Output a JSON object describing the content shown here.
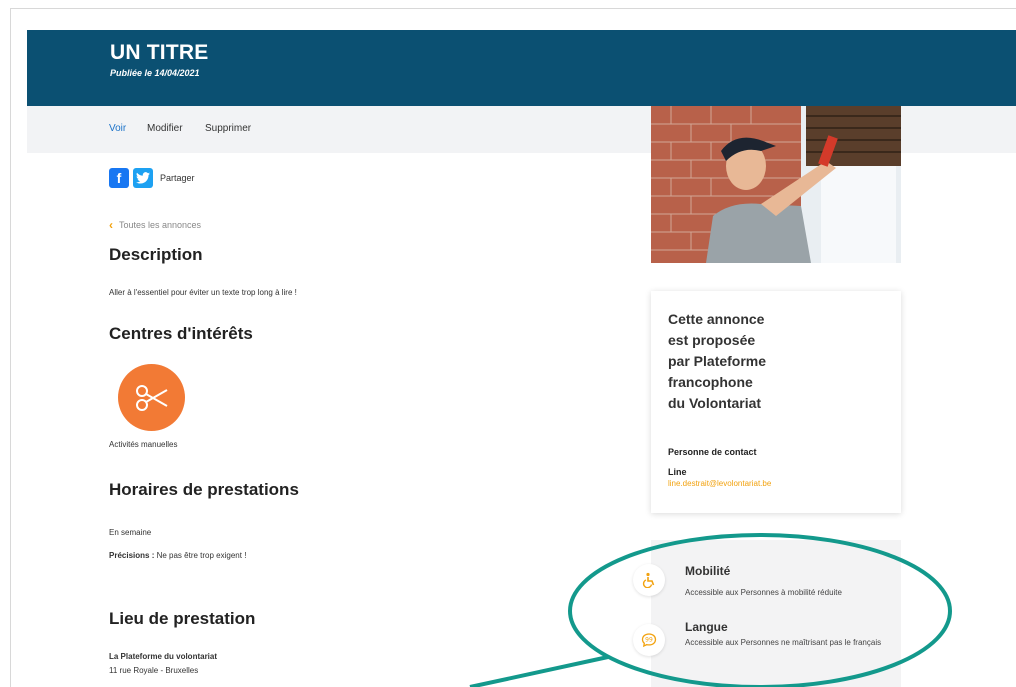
{
  "header": {
    "title": "UN TITRE",
    "date": "Publiée le 14/04/2021",
    "background": "#0b5072"
  },
  "tabs": [
    {
      "label": "Voir",
      "active": true
    },
    {
      "label": "Modifier",
      "active": false
    },
    {
      "label": "Supprimer",
      "active": false
    }
  ],
  "share": {
    "label": "Partager",
    "fb_letter": "f"
  },
  "back_link": "Toutes les annonces",
  "description": {
    "heading": "Description",
    "text": "Aller à l'essentiel pour éviter un texte trop long à lire !"
  },
  "interests": {
    "heading": "Centres d'intérêts",
    "items": [
      {
        "label": "Activités manuelles",
        "icon": "scissors-icon",
        "color": "#f27a35"
      }
    ]
  },
  "schedule": {
    "heading": "Horaires de prestations",
    "text": "En semaine",
    "precisions_label": "Précisions :",
    "precisions_text": " Ne pas être trop exigent !"
  },
  "location": {
    "heading": "Lieu de prestation",
    "name": "La Plateforme du volontariat",
    "address": "11 rue Royale - Bruxelles"
  },
  "card": {
    "org_lines": [
      "Cette annonce",
      "est proposée",
      "par Plateforme",
      "francophone",
      "du Volontariat"
    ],
    "contact_label": "Personne de contact",
    "contact_name": "Line",
    "contact_email": "line.destrait@levolontariat.be"
  },
  "accessibility": [
    {
      "title": "Mobilité",
      "description": "Accessible aux Personnes à mobilité réduite",
      "icon": "wheelchair-icon"
    },
    {
      "title": "Langue",
      "description": "Accessible aux Personnes ne maîtrisant pas le français",
      "icon": "speech-bubble-icon"
    }
  ],
  "colors": {
    "accent": "#f2a20f",
    "link": "#1d73c9",
    "annotation": "#13998c"
  }
}
